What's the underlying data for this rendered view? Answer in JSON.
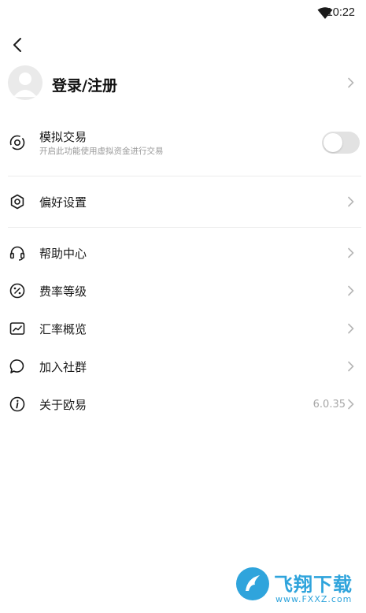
{
  "status_bar": {
    "time": "10:22",
    "wifi_icon": "wifi-icon"
  },
  "header": {
    "back_icon": "back-chevron-icon"
  },
  "profile": {
    "avatar_icon": "avatar-icon",
    "login_label": "登录/注册"
  },
  "demo_trading": {
    "icon": "target-icon",
    "title": "模拟交易",
    "subtitle": "开启此功能使用虚拟资金进行交易",
    "enabled": false
  },
  "menu": {
    "preferences": {
      "label": "偏好设置",
      "icon": "gear-icon"
    },
    "help": {
      "label": "帮助中心",
      "icon": "headset-icon"
    },
    "fees": {
      "label": "费率等级",
      "icon": "percent-icon"
    },
    "rates": {
      "label": "汇率概览",
      "icon": "trend-icon"
    },
    "community": {
      "label": "加入社群",
      "icon": "chat-bubble-icon"
    },
    "about": {
      "label": "关于欧易",
      "icon": "info-icon",
      "version": "6.0.35"
    }
  },
  "watermark": {
    "brand": "飞翔下载",
    "url": "www.FXXZ.com"
  },
  "colors": {
    "text": "#1a1a1a",
    "subtext": "#9a9a9a",
    "chevron": "#b5b5b5",
    "divider": "#ececec",
    "toggle_off": "#e2e2e2",
    "watermark": "#2fa4dc"
  }
}
